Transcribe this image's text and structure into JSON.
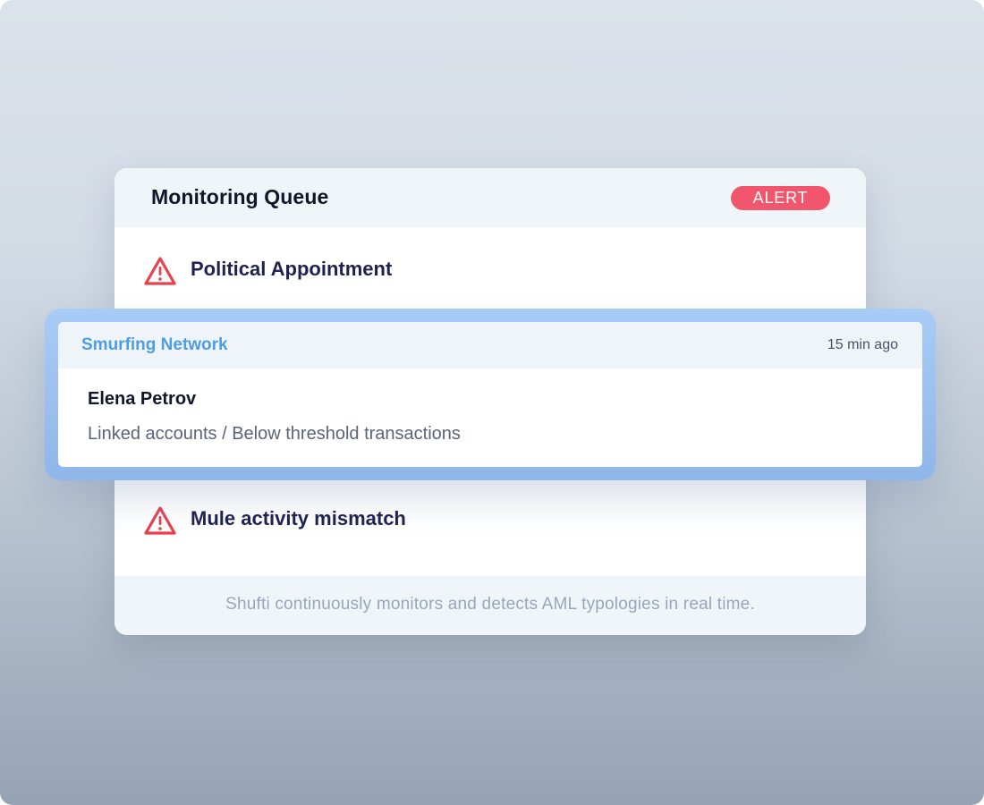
{
  "queue": {
    "title": "Monitoring Queue",
    "badge": "ALERT",
    "items": [
      {
        "label": "Political Appointment",
        "icon": "warning-icon"
      },
      {
        "label": "Mule activity mismatch",
        "icon": "warning-icon"
      }
    ],
    "footer": "Shufti continuously monitors and detects AML typologies in real time."
  },
  "highlight": {
    "category": "Smurfing Network",
    "time": "15 min ago",
    "name": "Elena Petrov",
    "description": "Linked accounts / Below threshold transactions"
  },
  "colors": {
    "alert": "#f2566d",
    "accent": "#4d9ce8",
    "highlight_frame": "#a9ccf6",
    "title_text": "#1f2151"
  }
}
